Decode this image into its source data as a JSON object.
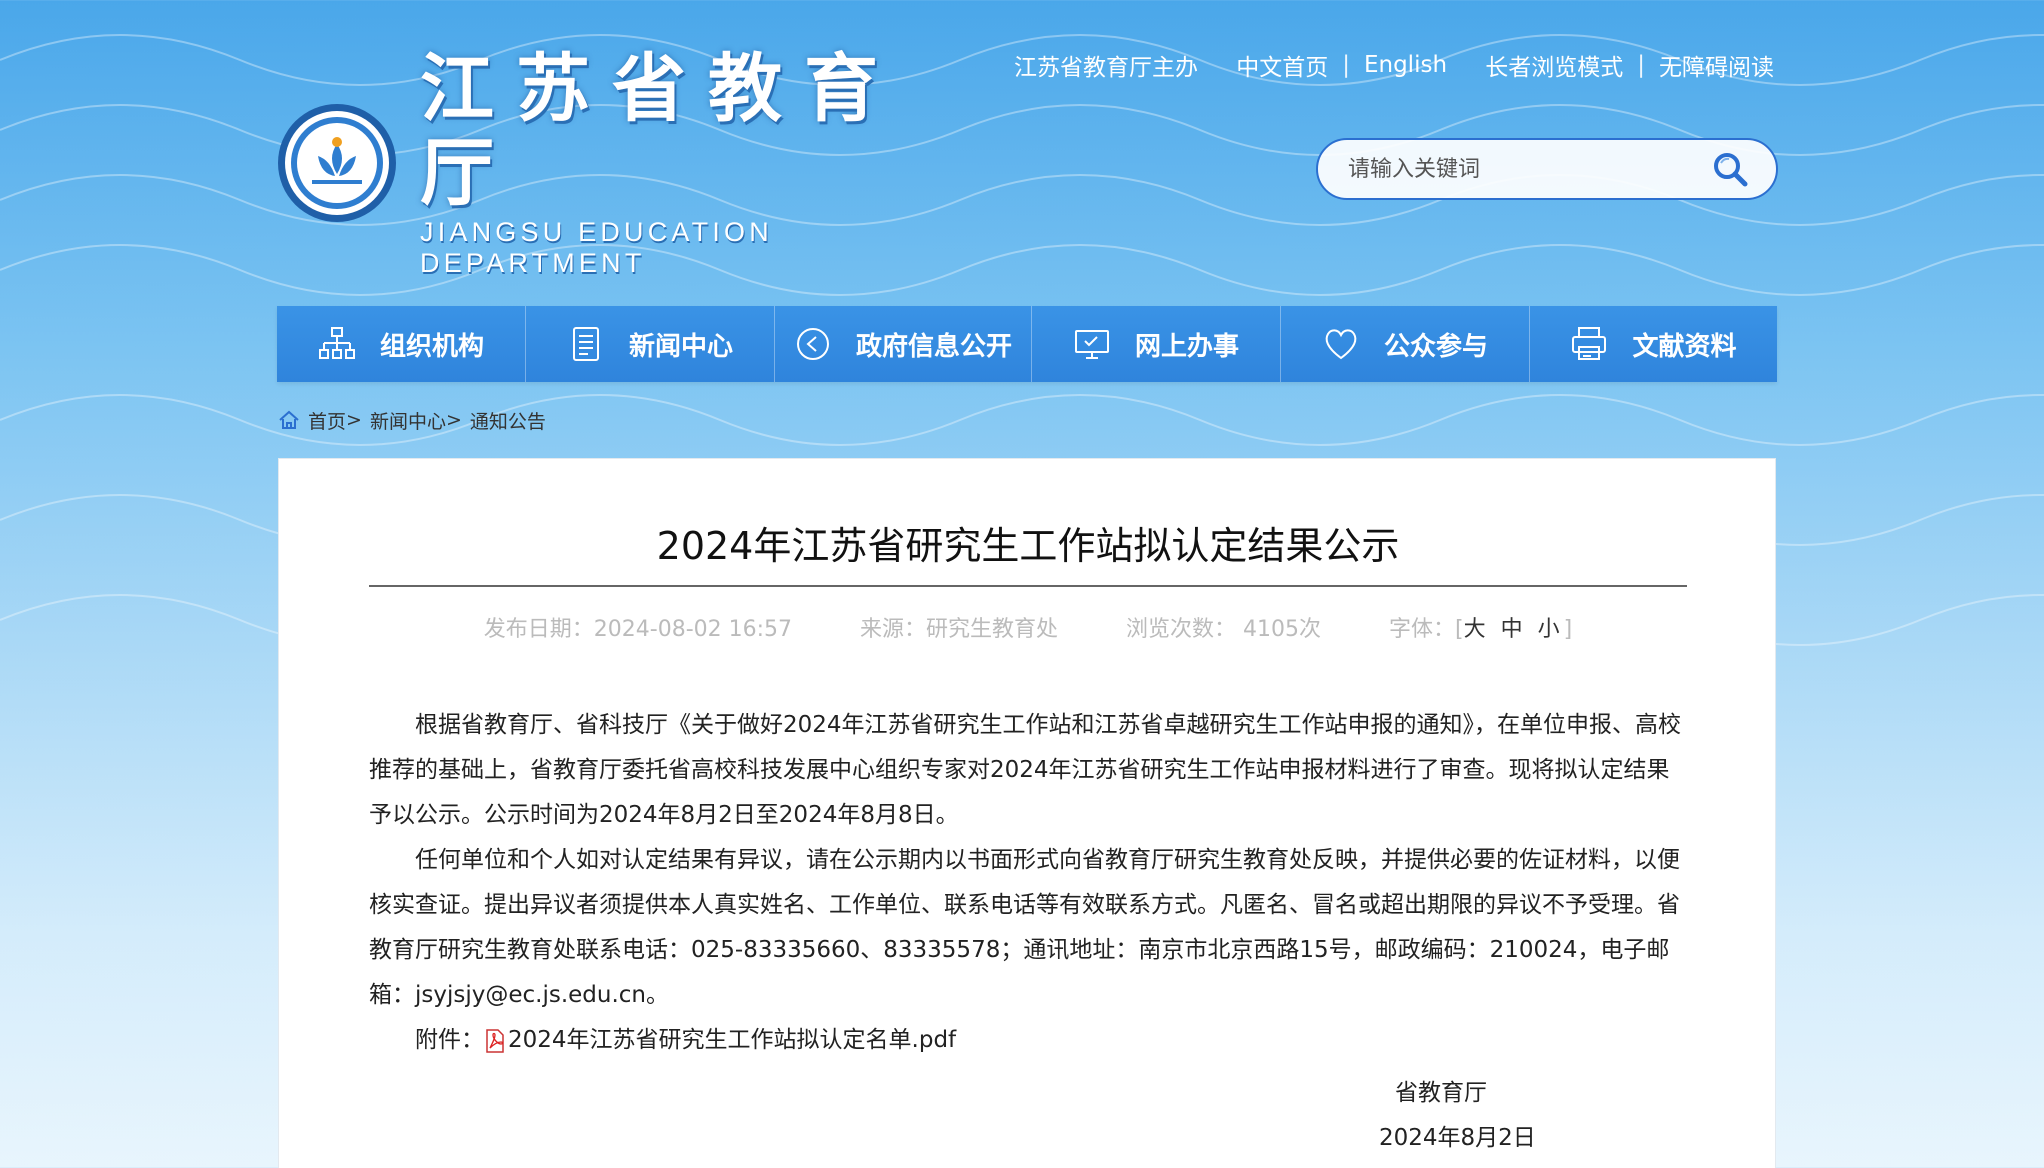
{
  "header": {
    "host": "江苏省教育厅主办",
    "home_cn": "中文首页",
    "english": "English",
    "elder_mode": "长者浏览模式",
    "accessible": "无障碍阅读",
    "separator": "|",
    "logo_cn": "江苏省教育厅",
    "logo_en": "JIANGSU EDUCATION DEPARTMENT"
  },
  "search": {
    "placeholder": "请输入关键词"
  },
  "nav": [
    {
      "label": "组织机构",
      "icon": "org-chart-icon"
    },
    {
      "label": "新闻中心",
      "icon": "document-icon"
    },
    {
      "label": "政府信息公开",
      "icon": "info-share-icon"
    },
    {
      "label": "网上办事",
      "icon": "monitor-icon"
    },
    {
      "label": "公众参与",
      "icon": "heart-icon"
    },
    {
      "label": "文献资料",
      "icon": "printer-icon"
    }
  ],
  "breadcrumb": {
    "home": "首页",
    "news": "新闻中心",
    "current": "通知公告",
    "sep": ">"
  },
  "article": {
    "title": "2024年江苏省研究生工作站拟认定结果公示",
    "date": "发布日期：2024-08-02 16:57",
    "source": "来源：研究生教育处",
    "views": "浏览次数： 4105次",
    "font_label": "字体：[",
    "font_sizes": "大 中 小",
    "font_close": "]",
    "p1": "根据省教育厅、省科技厅《关于做好2024年江苏省研究生工作站和江苏省卓越研究生工作站申报的通知》，在单位申报、高校推荐的基础上，省教育厅委托省高校科技发展中心组织专家对2024年江苏省研究生工作站申报材料进行了审查。现将拟认定结果予以公示。公示时间为2024年8月2日至2024年8月8日。",
    "p2": "任何单位和个人如对认定结果有异议，请在公示期内以书面形式向省教育厅研究生教育处反映，并提供必要的佐证材料，以便核实查证。提出异议者须提供本人真实姓名、工作单位、联系电话等有效联系方式。凡匿名、冒名或超出期限的异议不予受理。省教育厅研究生教育处联系电话：025-83335660、83335578；通讯地址：南京市北京西路15号，邮政编码：210024，电子邮箱：jsyjsjy@ec.js.edu.cn。",
    "attach_label": "附件：",
    "attach_file": "2024年江苏省研究生工作站拟认定名单.pdf",
    "sign_org": "省教育厅",
    "sign_date": "2024年8月2日"
  },
  "colors": {
    "nav_bg": "#2f84dc",
    "accent": "#2b6fd0",
    "sky": "#4aa7ea"
  }
}
